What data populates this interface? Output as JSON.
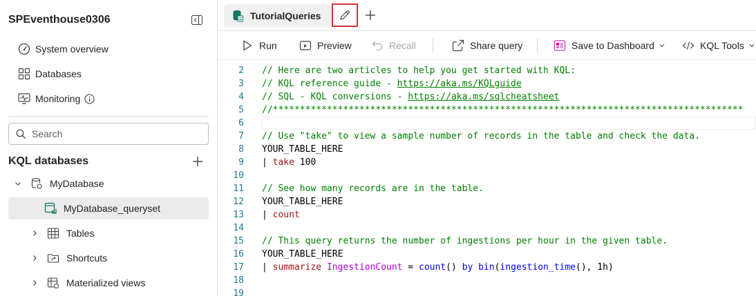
{
  "sidebar": {
    "title": "SPEventhouse0306",
    "nav": [
      {
        "label": "System overview",
        "icon": "gauge-icon"
      },
      {
        "label": "Databases",
        "icon": "grid-icon"
      },
      {
        "label": "Monitoring",
        "icon": "monitor-pulse-icon"
      }
    ],
    "search_placeholder": "Search",
    "section_title": "KQL databases",
    "tree": {
      "database": "MyDatabase",
      "queryset": "MyDatabase_queryset",
      "children": [
        "Tables",
        "Shortcuts",
        "Materialized views"
      ]
    }
  },
  "tabs": [
    {
      "label": "TutorialQueries",
      "icon": "queryset-icon"
    }
  ],
  "toolbar": {
    "run": "Run",
    "preview": "Preview",
    "recall": "Recall",
    "share": "Share query",
    "save_dashboard": "Save to Dashboard",
    "kql_tools": "KQL Tools"
  },
  "editor": {
    "lines": [
      {
        "n": "2",
        "segs": [
          {
            "t": "// Here are two articles to help you get started with KQL:",
            "c": "comment"
          }
        ]
      },
      {
        "n": "3",
        "segs": [
          {
            "t": "// KQL reference guide - ",
            "c": "comment"
          },
          {
            "t": "https://aka.ms/KQLguide",
            "c": "link"
          }
        ]
      },
      {
        "n": "4",
        "segs": [
          {
            "t": "// SQL - KQL conversions - ",
            "c": "comment"
          },
          {
            "t": "https://aka.ms/sqlcheatsheet",
            "c": "link"
          }
        ]
      },
      {
        "n": "5",
        "segs": [
          {
            "t": "//***************************************************************************************",
            "c": "comment"
          }
        ]
      },
      {
        "n": "6",
        "segs": [],
        "current": true
      },
      {
        "n": "7",
        "segs": [
          {
            "t": "// Use \"take\" to view a sample number of records in the table and check the data.",
            "c": "comment"
          }
        ]
      },
      {
        "n": "8",
        "segs": [
          {
            "t": "YOUR_TABLE_HERE",
            "c": "plain"
          }
        ]
      },
      {
        "n": "9",
        "segs": [
          {
            "t": "| ",
            "c": "plain"
          },
          {
            "t": "take",
            "c": "kw"
          },
          {
            "t": " 100",
            "c": "plain"
          }
        ]
      },
      {
        "n": "10",
        "segs": []
      },
      {
        "n": "11",
        "segs": [
          {
            "t": "// See how many records are in the table.",
            "c": "comment"
          }
        ]
      },
      {
        "n": "12",
        "segs": [
          {
            "t": "YOUR_TABLE_HERE",
            "c": "plain"
          }
        ]
      },
      {
        "n": "13",
        "segs": [
          {
            "t": "| ",
            "c": "plain"
          },
          {
            "t": "count",
            "c": "kw"
          }
        ]
      },
      {
        "n": "14",
        "segs": []
      },
      {
        "n": "15",
        "segs": [
          {
            "t": "// This query returns the number of ingestions per hour in the given table.",
            "c": "comment"
          }
        ]
      },
      {
        "n": "16",
        "segs": [
          {
            "t": "YOUR_TABLE_HERE",
            "c": "plain"
          }
        ]
      },
      {
        "n": "17",
        "segs": [
          {
            "t": "| ",
            "c": "plain"
          },
          {
            "t": "summarize",
            "c": "kw"
          },
          {
            "t": " ",
            "c": "plain"
          },
          {
            "t": "IngestionCount",
            "c": "col"
          },
          {
            "t": " = ",
            "c": "plain"
          },
          {
            "t": "count",
            "c": "fn"
          },
          {
            "t": "() ",
            "c": "plain"
          },
          {
            "t": "by",
            "c": "fn"
          },
          {
            "t": " ",
            "c": "plain"
          },
          {
            "t": "bin",
            "c": "fn"
          },
          {
            "t": "(",
            "c": "plain"
          },
          {
            "t": "ingestion_time",
            "c": "fn"
          },
          {
            "t": "(), 1h)",
            "c": "plain"
          }
        ]
      },
      {
        "n": "18",
        "segs": []
      },
      {
        "n": "19",
        "segs": []
      }
    ]
  },
  "colors": {
    "accent_red": "#d13438",
    "queryset_teal": "#117865",
    "comment_green": "#008000",
    "keyword_red": "#a31515",
    "column_purple": "#af00db",
    "function_blue": "#0000ff",
    "line_number": "#237893"
  }
}
